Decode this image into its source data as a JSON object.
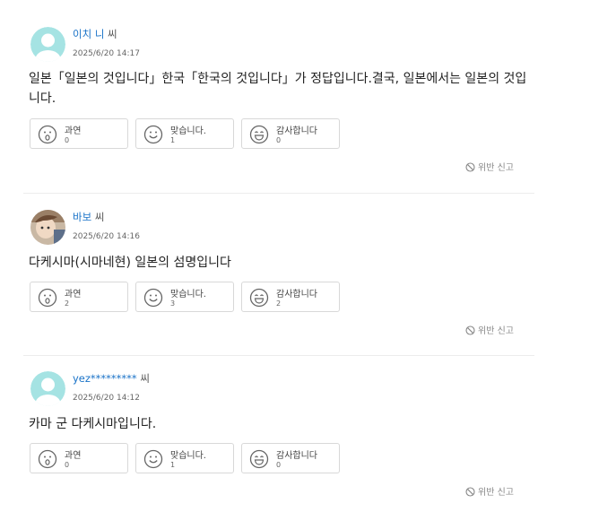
{
  "comments": [
    {
      "avatar": "default-avatar-icon",
      "name": "이치 니",
      "suffix": " 씨",
      "date": "2025/6/20 14:17",
      "text": "일본「일본의 것입니다」한국「한국의 것입니다」가 정답입니다.결국, 일본에서는 일본의 것입니다.",
      "reactions": [
        {
          "icon": "surprised-face-icon",
          "label": "과연",
          "count": "0"
        },
        {
          "icon": "smile-face-icon",
          "label": "맞습니다.",
          "count": "1"
        },
        {
          "icon": "grin-face-icon",
          "label": "감사합니다",
          "count": "0"
        }
      ],
      "report": "위반 신고"
    },
    {
      "avatar": "photo-avatar",
      "name": "바보",
      "suffix": " 씨",
      "date": "2025/6/20 14:16",
      "text": "다케시마(시마네현) 일본의 섬명입니다",
      "reactions": [
        {
          "icon": "surprised-face-icon",
          "label": "과연",
          "count": "2"
        },
        {
          "icon": "smile-face-icon",
          "label": "맞습니다.",
          "count": "3"
        },
        {
          "icon": "grin-face-icon",
          "label": "감사합니다",
          "count": "2"
        }
      ],
      "report": "위반 신고"
    },
    {
      "avatar": "default-avatar-icon",
      "name": "yez*********",
      "suffix": " 씨",
      "date": "2025/6/20 14:12",
      "text": "카마 군 다케시마입니다.",
      "reactions": [
        {
          "icon": "surprised-face-icon",
          "label": "과연",
          "count": "0"
        },
        {
          "icon": "smile-face-icon",
          "label": "맞습니다.",
          "count": "1"
        },
        {
          "icon": "grin-face-icon",
          "label": "감사합니다",
          "count": "0"
        }
      ],
      "report": "위반 신고"
    }
  ],
  "colors": {
    "username": "#1a73c8",
    "avatar_bg": "#7fd3d6",
    "border": "#d8d8d8",
    "muted": "#888888"
  }
}
